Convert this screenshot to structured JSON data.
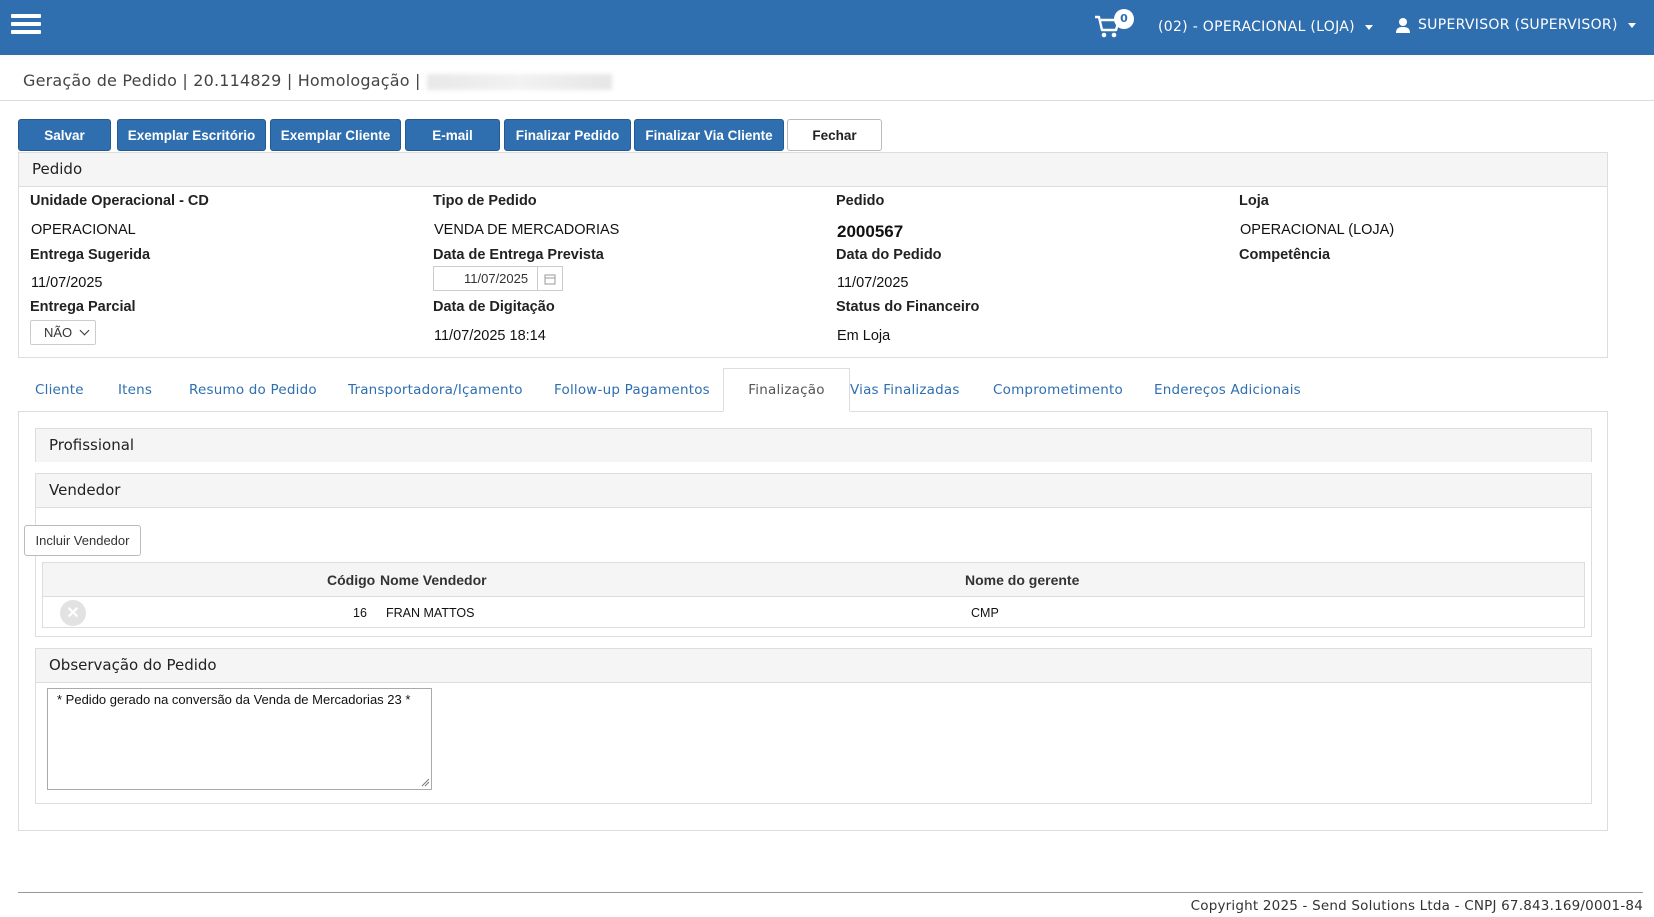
{
  "topbar": {
    "cart_count": "0",
    "store_selector": "(02) - OPERACIONAL (LOJA)",
    "user": "SUPERVISOR (SUPERVISOR)",
    "bg_color": "#2f6fb0"
  },
  "breadcrumb": {
    "text": "Geração de Pedido | 20.114829 | Homologação |"
  },
  "toolbar": {
    "salvar": "Salvar",
    "exemplar_escritorio": "Exemplar Escritório",
    "exemplar_cliente": "Exemplar Cliente",
    "email": "E-mail",
    "finalizar_pedido": "Finalizar Pedido",
    "finalizar_via_cliente": "Finalizar Via Cliente",
    "fechar": "Fechar"
  },
  "pedido": {
    "title": "Pedido",
    "unidade_label": "Unidade Operacional - CD",
    "unidade_value": "OPERACIONAL",
    "tipo_label": "Tipo de Pedido",
    "tipo_value": "VENDA DE MERCADORIAS",
    "pedido_label": "Pedido",
    "pedido_value": "2000567",
    "loja_label": "Loja",
    "loja_value": "OPERACIONAL (LOJA)",
    "entrega_sugerida_label": "Entrega Sugerida",
    "entrega_sugerida_value": "11/07/2025",
    "data_entrega_prevista_label": "Data de Entrega Prevista",
    "data_entrega_prevista_value": "11/07/2025",
    "data_pedido_label": "Data do Pedido",
    "data_pedido_value": "11/07/2025",
    "competencia_label": "Competência",
    "entrega_parcial_label": "Entrega Parcial",
    "entrega_parcial_value": "NÃO",
    "data_digitacao_label": "Data de Digitação",
    "data_digitacao_value": "11/07/2025 18:14",
    "status_financeiro_label": "Status do Financeiro",
    "status_financeiro_value": "Em Loja"
  },
  "tabs": [
    {
      "label": "Cliente"
    },
    {
      "label": "Itens"
    },
    {
      "label": "Resumo do Pedido"
    },
    {
      "label": "Transportadora/Içamento"
    },
    {
      "label": "Follow-up Pagamentos"
    },
    {
      "label": "Finalização",
      "active": true
    },
    {
      "label": "Vias Finalizadas"
    },
    {
      "label": "Comprometimento"
    },
    {
      "label": "Endereços Adicionais"
    }
  ],
  "finalizacao": {
    "profissional_title": "Profissional",
    "vendedor_title": "Vendedor",
    "incluir_vendedor": "Incluir Vendedor",
    "table_headers": {
      "codigo": "Código",
      "nome_vendedor": "Nome Vendedor",
      "nome_gerente": "Nome do gerente"
    },
    "rows": [
      {
        "codigo": "16",
        "nome_vendedor": "FRAN MATTOS",
        "nome_gerente": "CMP"
      }
    ],
    "observacao_title": "Observação do Pedido",
    "observacao_text": "* Pedido gerado na conversão da Venda de Mercadorias 23 *"
  },
  "footer": {
    "copyright": "Copyright 2025 - Send Solutions Ltda - CNPJ 67.843.169/0001-84"
  }
}
